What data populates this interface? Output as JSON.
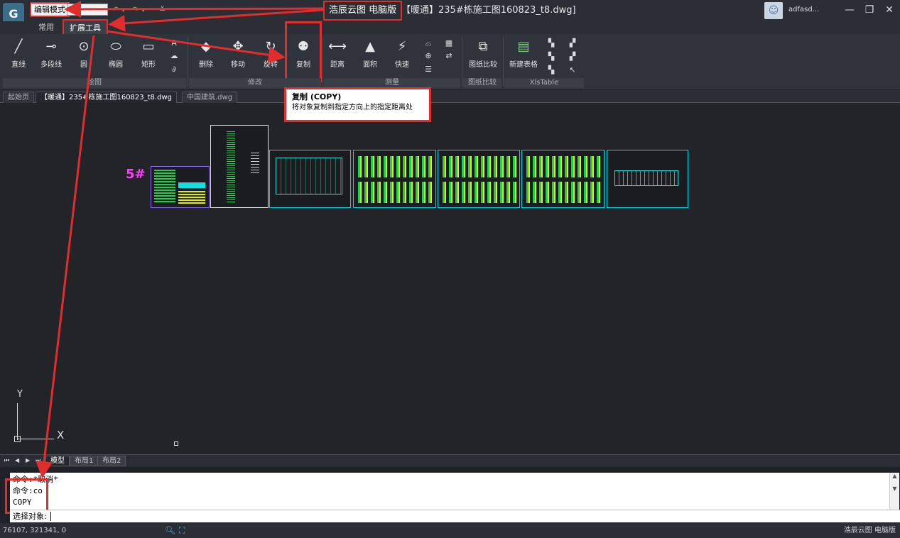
{
  "titlebar": {
    "mode_label": "编辑模式",
    "app_title": "浩辰云图 电脑版",
    "file_title": "【暖通】235#栋施工图160823_t8.dwg]",
    "user_name": "adfasd...",
    "min": "—",
    "max": "❐",
    "close": "✕"
  },
  "ribbon_tabs": [
    "常用",
    "扩展工具"
  ],
  "ribbon": {
    "draw": [
      "直线",
      "多段线",
      "圆",
      "椭圆",
      "矩形"
    ],
    "modify": [
      "删除",
      "移动",
      "旋转",
      "复制"
    ],
    "measure": [
      "距离",
      "面积",
      "快速"
    ],
    "compare": [
      "图纸比较"
    ],
    "table": [
      "新建表格"
    ],
    "groups": [
      "绘图",
      "修改",
      "测量",
      "图纸比较",
      "XlsTable"
    ],
    "text_tool": "A"
  },
  "tooltip": {
    "title": "复制 (COPY)",
    "desc": "将对象复制到指定方向上的指定距离处"
  },
  "doc_tabs": [
    "起始页",
    "【暖通】235#栋施工图160823_t8.dwg",
    "中国建筑.dwg"
  ],
  "canvas": {
    "label": "5#",
    "ucs_y": "Y",
    "ucs_x": "X"
  },
  "layout_tabs": [
    "模型",
    "布局1",
    "布局2"
  ],
  "command": {
    "lines": [
      "命令:*取消*",
      "命令:co",
      "COPY"
    ],
    "prompt": "选择对象:"
  },
  "status": {
    "coords": "76107, 321341, 0",
    "app": "浩辰云图 电脑版"
  },
  "colors": {
    "highlight": "#e12d2d",
    "sheet_border": "#00d7e6",
    "label": "#ff40ff"
  }
}
